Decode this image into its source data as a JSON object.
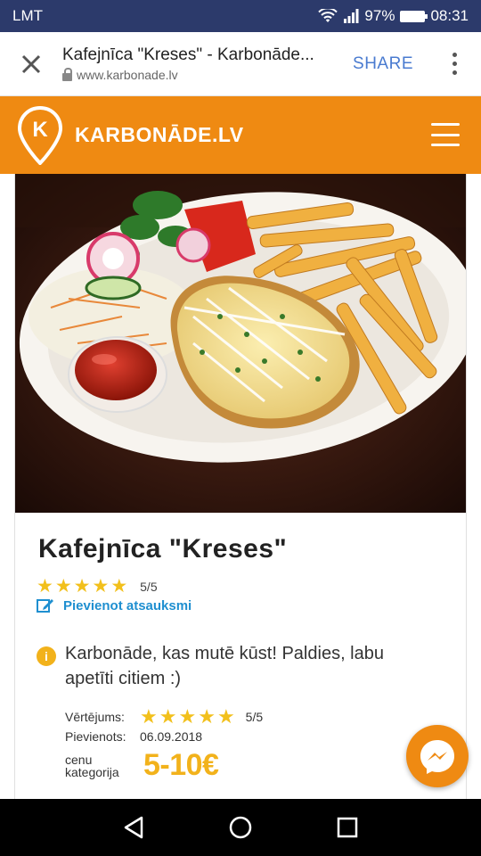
{
  "status_bar": {
    "carrier": "LMT",
    "battery": "97%",
    "battery_level": 0.97,
    "time": "08:31"
  },
  "browser": {
    "title": "Kafejnīca \"Kreses\" - Karbonāde...",
    "url": "www.karbonade.lv",
    "share_label": "SHARE",
    "close_icon": "close-icon",
    "menu_icon": "more-vert-icon"
  },
  "site": {
    "name": "KARBONĀDE.LV",
    "logo_letter": "K",
    "accent": "#ef8a12"
  },
  "restaurant": {
    "name": "Kafejnīca \"Kreses\"",
    "rating": 5,
    "rating_max": 5,
    "rating_text": "5/5",
    "add_review_label": "Pievienot atsauksmi"
  },
  "review": {
    "info_icon": "i",
    "text": "Karbonāde, kas mutē kūst! Paldies, labu apetīti citiem :)",
    "rating_label": "Vērtējums:",
    "rating": 5,
    "rating_text": "5/5",
    "added_label": "Pievienots:",
    "added_date": "06.09.2018",
    "price_label": "cenu kategorija",
    "price_value": "5-10€"
  },
  "nav": {
    "back_icon": "back-icon",
    "home_icon": "home-icon",
    "recents_icon": "recents-icon"
  }
}
